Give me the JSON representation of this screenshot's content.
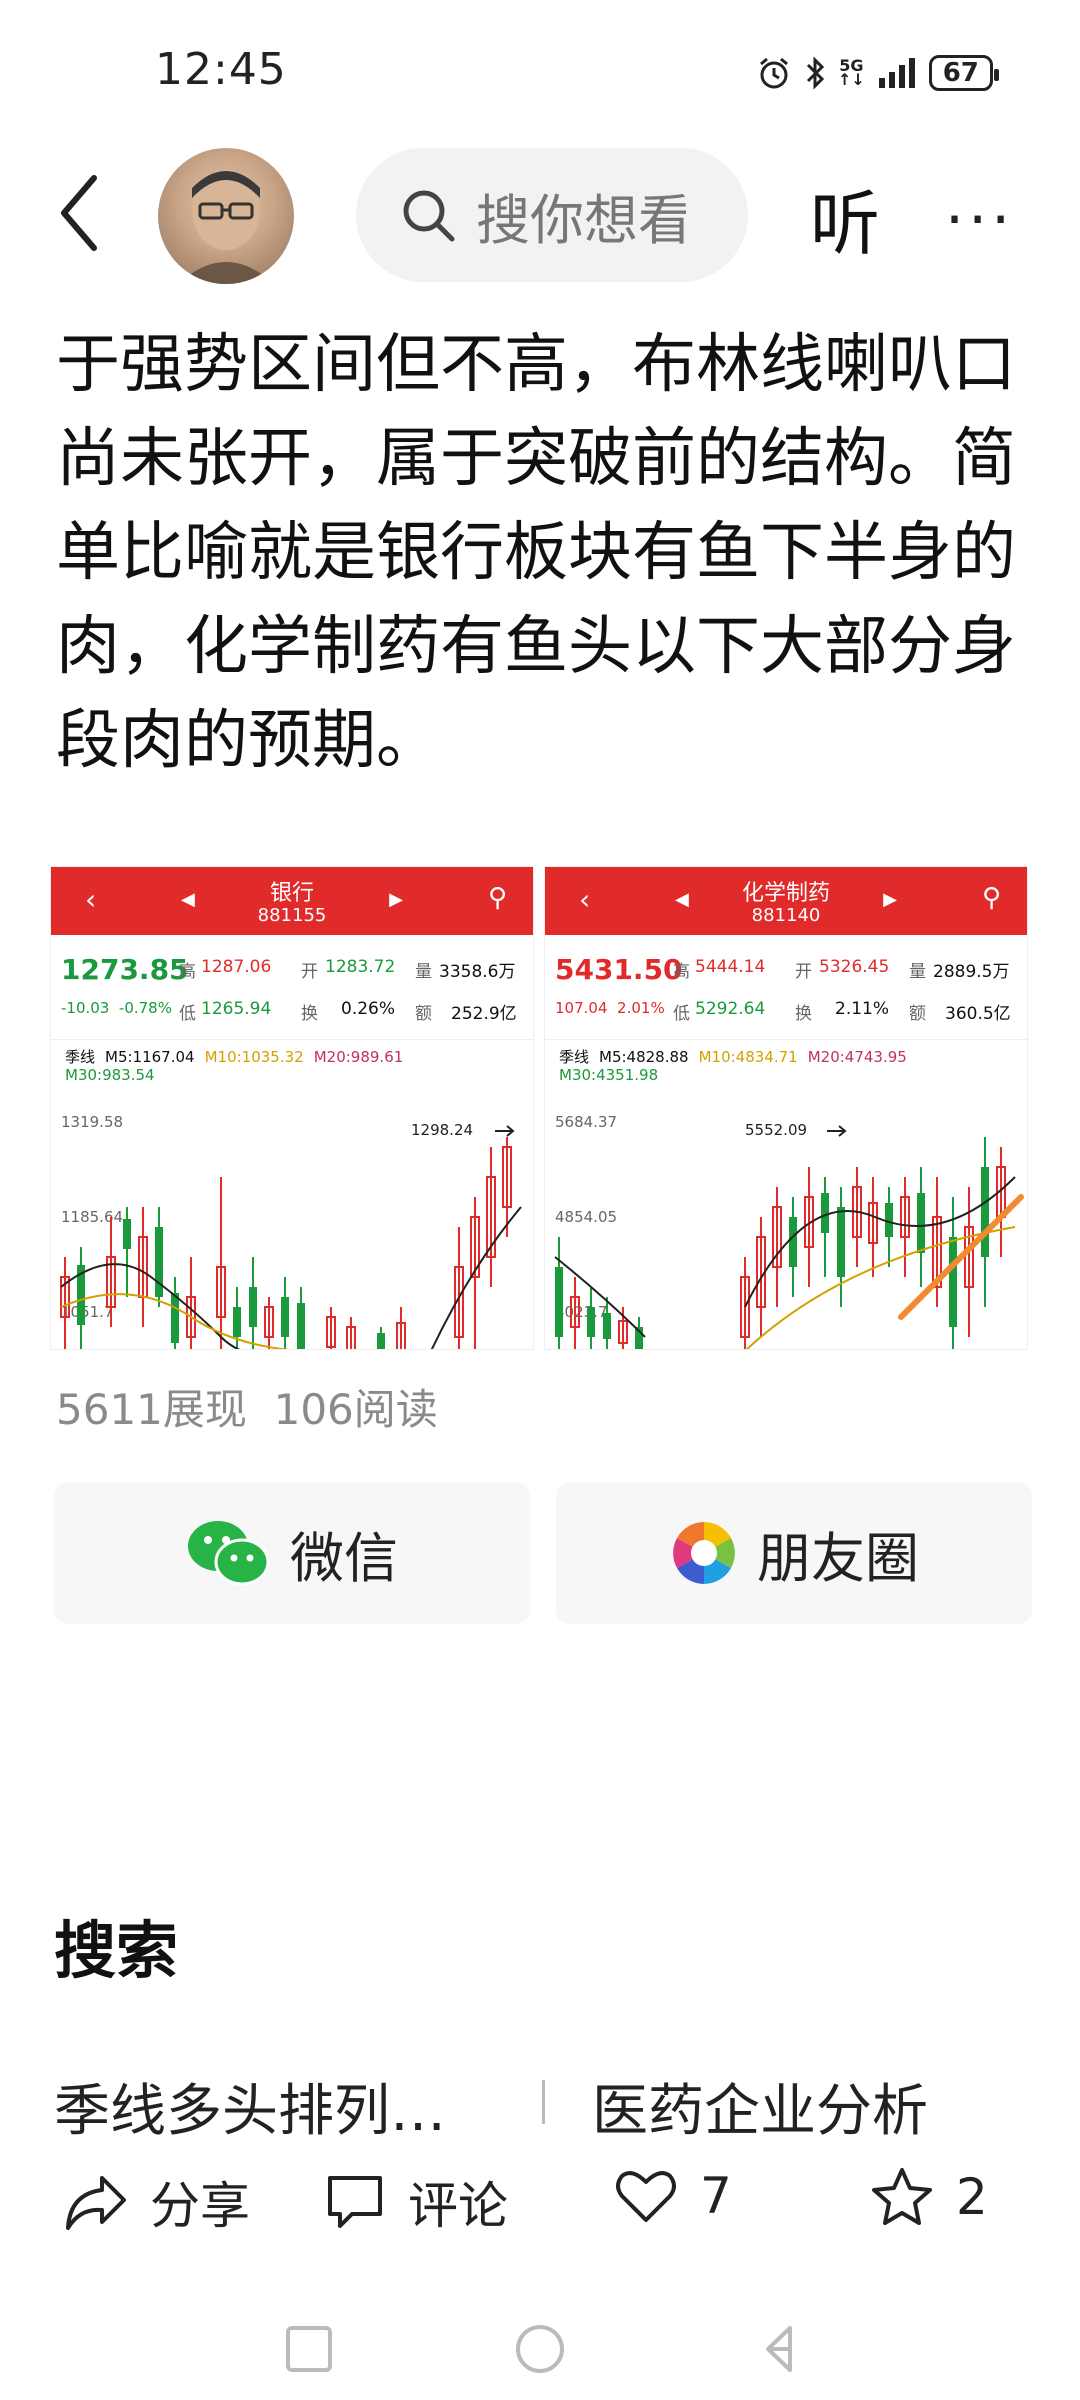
{
  "status": {
    "time": "12:45",
    "network": "5G",
    "battery": "67"
  },
  "header": {
    "search_placeholder": "搜你想看",
    "listen_label": "听",
    "more_label": "···"
  },
  "article": {
    "text": "于强势区间但不高，布林线喇叭口尚未张开，属于突破前的结构。简单比喻就是银行板块有鱼下半身的肉，化学制药有鱼头以下大部分身段肉的预期。"
  },
  "cards": [
    {
      "name": "银行",
      "code": "881155",
      "price": "1273.85",
      "change": "-10.03",
      "change_pct": "-0.78%",
      "high_label": "高",
      "high": "1287.06",
      "open_label": "开",
      "open": "1283.72",
      "vol_label": "量",
      "vol": "3358.6万",
      "low_label": "低",
      "low": "1265.94",
      "turn_label": "换",
      "turn": "0.26%",
      "amt_label": "额",
      "amt": "252.9亿",
      "period": "季线",
      "m5": "M5:1167.04",
      "m10": "M10:1035.32",
      "m20": "M20:989.61",
      "m30": "M30:983.54",
      "y_top": "1319.58",
      "y_mid": "1185.64",
      "y_low": "1051.7",
      "peak_label": "1298.24",
      "color": "#1a9a3c"
    },
    {
      "name": "化学制药",
      "code": "881140",
      "price": "5431.50",
      "change": "107.04",
      "change_pct": "2.01%",
      "high_label": "高",
      "high": "5444.14",
      "open_label": "开",
      "open": "5326.45",
      "vol_label": "量",
      "vol": "2889.5万",
      "low_label": "低",
      "low": "5292.64",
      "turn_label": "换",
      "turn": "2.11%",
      "amt_label": "额",
      "amt": "360.5亿",
      "period": "季线",
      "m5": "M5:4828.88",
      "m10": "M10:4834.71",
      "m20": "M20:4743.95",
      "m30": "M30:4351.98",
      "y_top": "5684.37",
      "y_mid": "4854.05",
      "y_low": "4023.7",
      "peak_label": "5552.09",
      "color": "#e12b2b"
    }
  ],
  "stats": {
    "views": "5611展现",
    "reads": "106阅读"
  },
  "share": {
    "wechat": "微信",
    "moments": "朋友圈"
  },
  "search_section": {
    "title": "搜索",
    "suggest1": "季线多头排列…",
    "suggest2": "医药企业分析"
  },
  "actions": {
    "share": "分享",
    "comment": "评论",
    "likes": "7",
    "favorites": "2"
  }
}
